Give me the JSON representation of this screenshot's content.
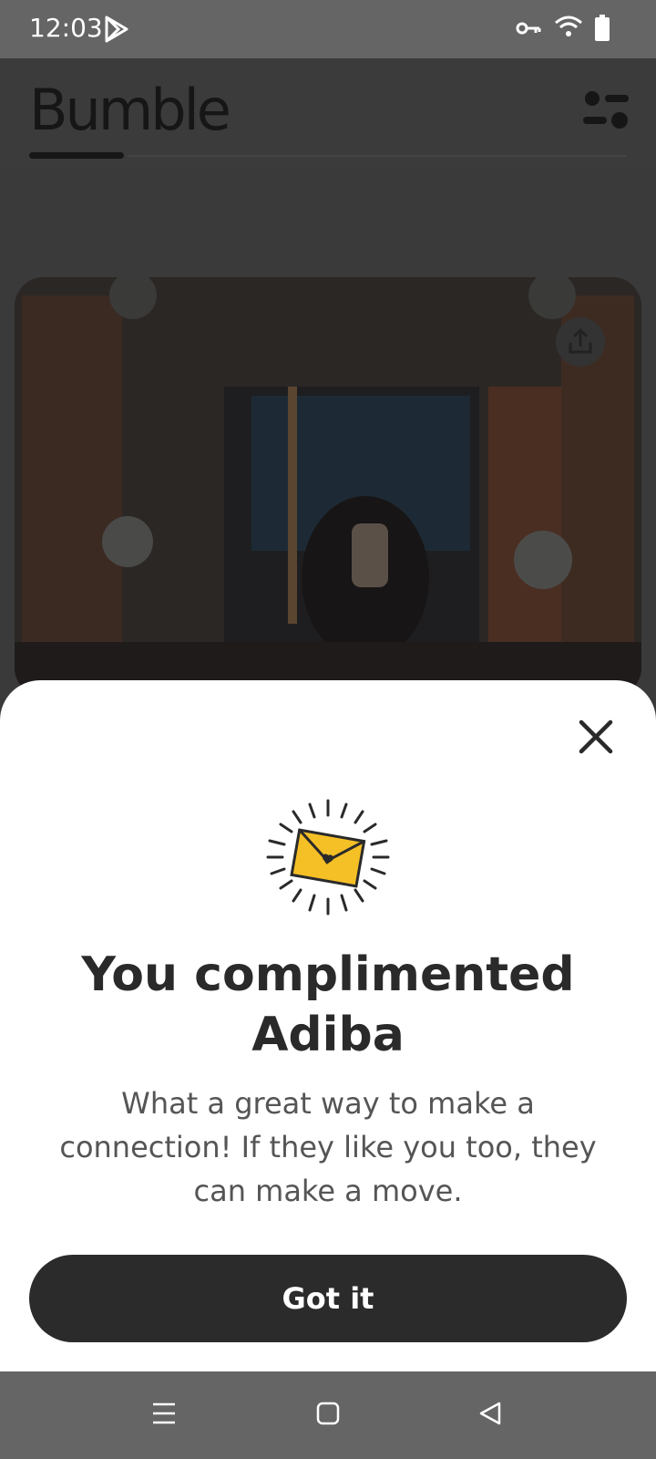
{
  "status": {
    "time": "12:03"
  },
  "header": {
    "logo": "Bumble"
  },
  "sheet": {
    "title_line1": "You complimented",
    "title_line2": "Adiba",
    "subtitle_line1": "What a great way to make a",
    "subtitle_line2": "connection! If they like you too, they",
    "subtitle_line3": "can make a move.",
    "button_label": "Got it"
  },
  "icons": {
    "play": "play-store-icon",
    "key": "vpn-key-icon",
    "wifi": "wifi-icon",
    "battery": "battery-icon",
    "filter": "filter-icon",
    "share": "share-icon",
    "close": "close-icon",
    "envelope": "envelope-heart-icon",
    "nav_menu": "recents-icon",
    "nav_home": "home-icon",
    "nav_back": "back-icon"
  },
  "colors": {
    "accent": "#F5C026",
    "button": "#2B2B2B"
  }
}
